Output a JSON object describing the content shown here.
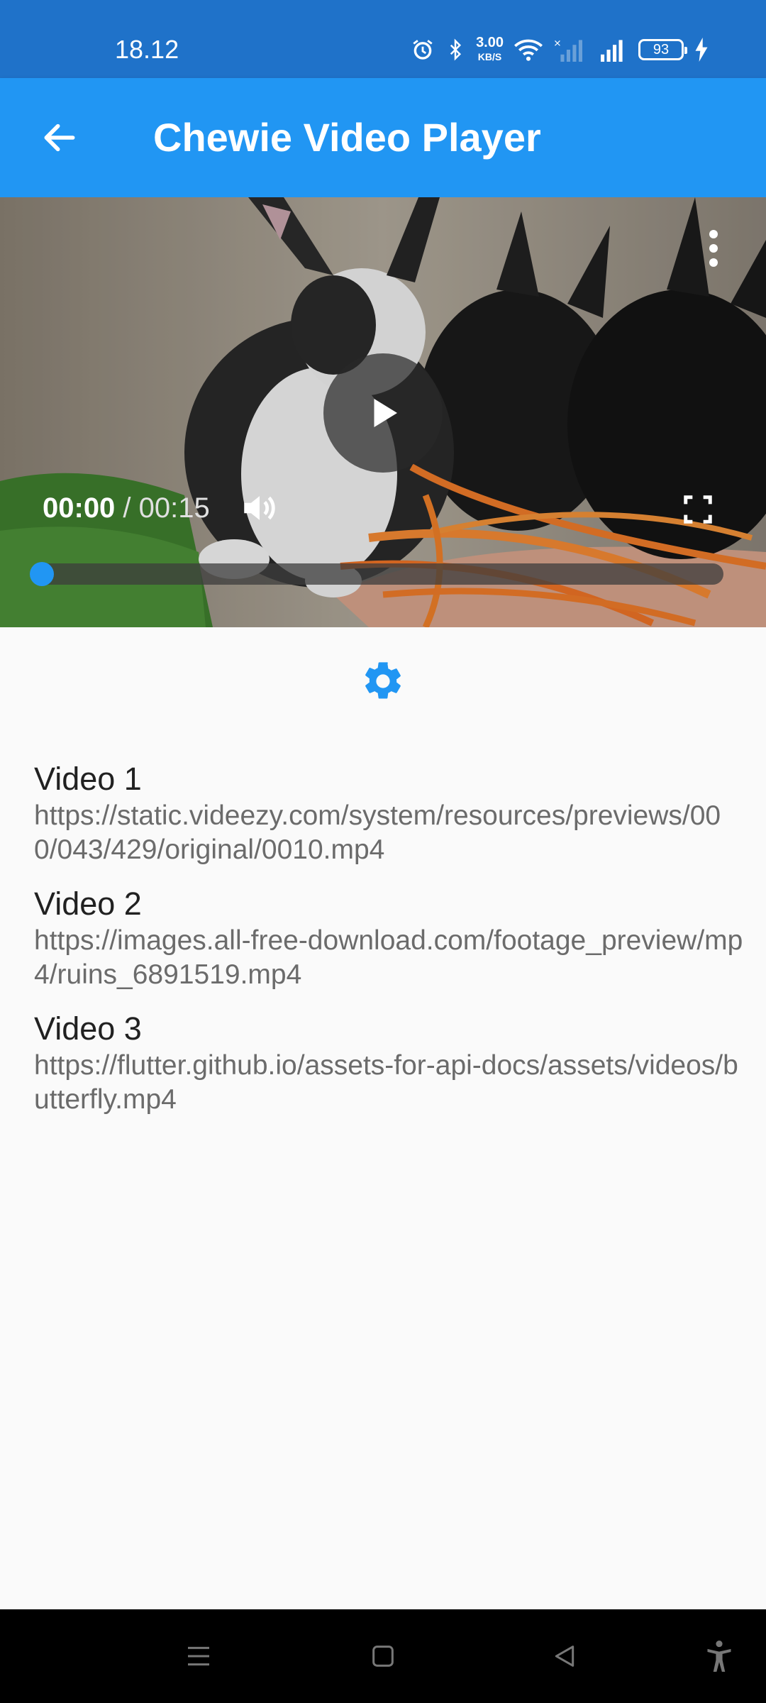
{
  "status_bar": {
    "time": "18.12",
    "net_speed_value": "3.00",
    "net_speed_unit": "KB/S",
    "battery_level": "93",
    "icons": [
      "alarm-icon",
      "bluetooth-icon",
      "wifi-icon",
      "signal-icon",
      "signal-icon",
      "charging-icon"
    ]
  },
  "app_bar": {
    "back_icon": "arrow-back-icon",
    "title": "Chewie Video Player"
  },
  "player": {
    "current_time": "00:00",
    "separator": " / ",
    "total_time": "00:15",
    "progress": 0.0,
    "accent_color": "#2196f3",
    "icons": [
      "play-icon",
      "more-vert-icon",
      "volume-icon",
      "fullscreen-icon"
    ]
  },
  "settings": {
    "icon": "settings-icon",
    "color": "#2196f3"
  },
  "videos": [
    {
      "title": "Video 1",
      "url": "https://static.videezy.com/system/resources/previews/000/043/429/original/0010.mp4"
    },
    {
      "title": "Video 2",
      "url": "https://images.all-free-download.com/footage_preview/mp4/ruins_6891519.mp4"
    },
    {
      "title": "Video 3",
      "url": "https://flutter.github.io/assets-for-api-docs/assets/videos/butterfly.mp4"
    }
  ],
  "nav_bar": {
    "icons": [
      "menu-icon",
      "home-icon",
      "back-icon",
      "accessibility-icon"
    ]
  },
  "colors": {
    "status_bar": "#1f72c9",
    "app_bar": "#2196f3",
    "background": "#fafafa"
  }
}
